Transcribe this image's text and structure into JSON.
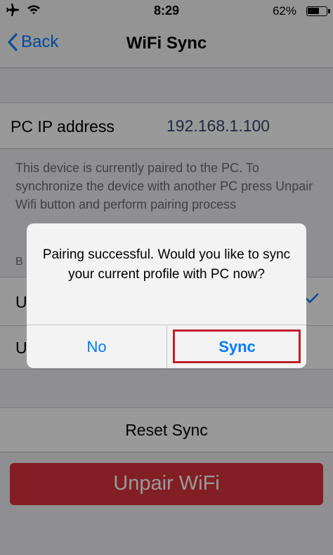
{
  "status_bar": {
    "time": "8:29",
    "battery_percent": "62%",
    "battery_level": 0.62,
    "icons": [
      "airplane-icon",
      "wifi-icon",
      "battery-icon"
    ]
  },
  "nav": {
    "back_label": "Back",
    "title": "WiFi Sync"
  },
  "ip_row": {
    "label": "PC IP address",
    "value": "192.168.1.100"
  },
  "pairing_info": "This device is currently paired to the PC. To synchronize the device with another PC press Unpair Wifi button and perform pairing process",
  "obscured": {
    "section_header_initial": "B",
    "row1_initial": "U",
    "row2_initial": "U"
  },
  "reset_sync_label": "Reset Sync",
  "unpair_label": "Unpair WiFi",
  "alert": {
    "message": "Pairing successful. Would you like to sync your current profile with PC now?",
    "no_label": "No",
    "sync_label": "Sync"
  },
  "colors": {
    "accent": "#007aff",
    "destructive": "#d9343d",
    "highlight": "#c0202a"
  }
}
